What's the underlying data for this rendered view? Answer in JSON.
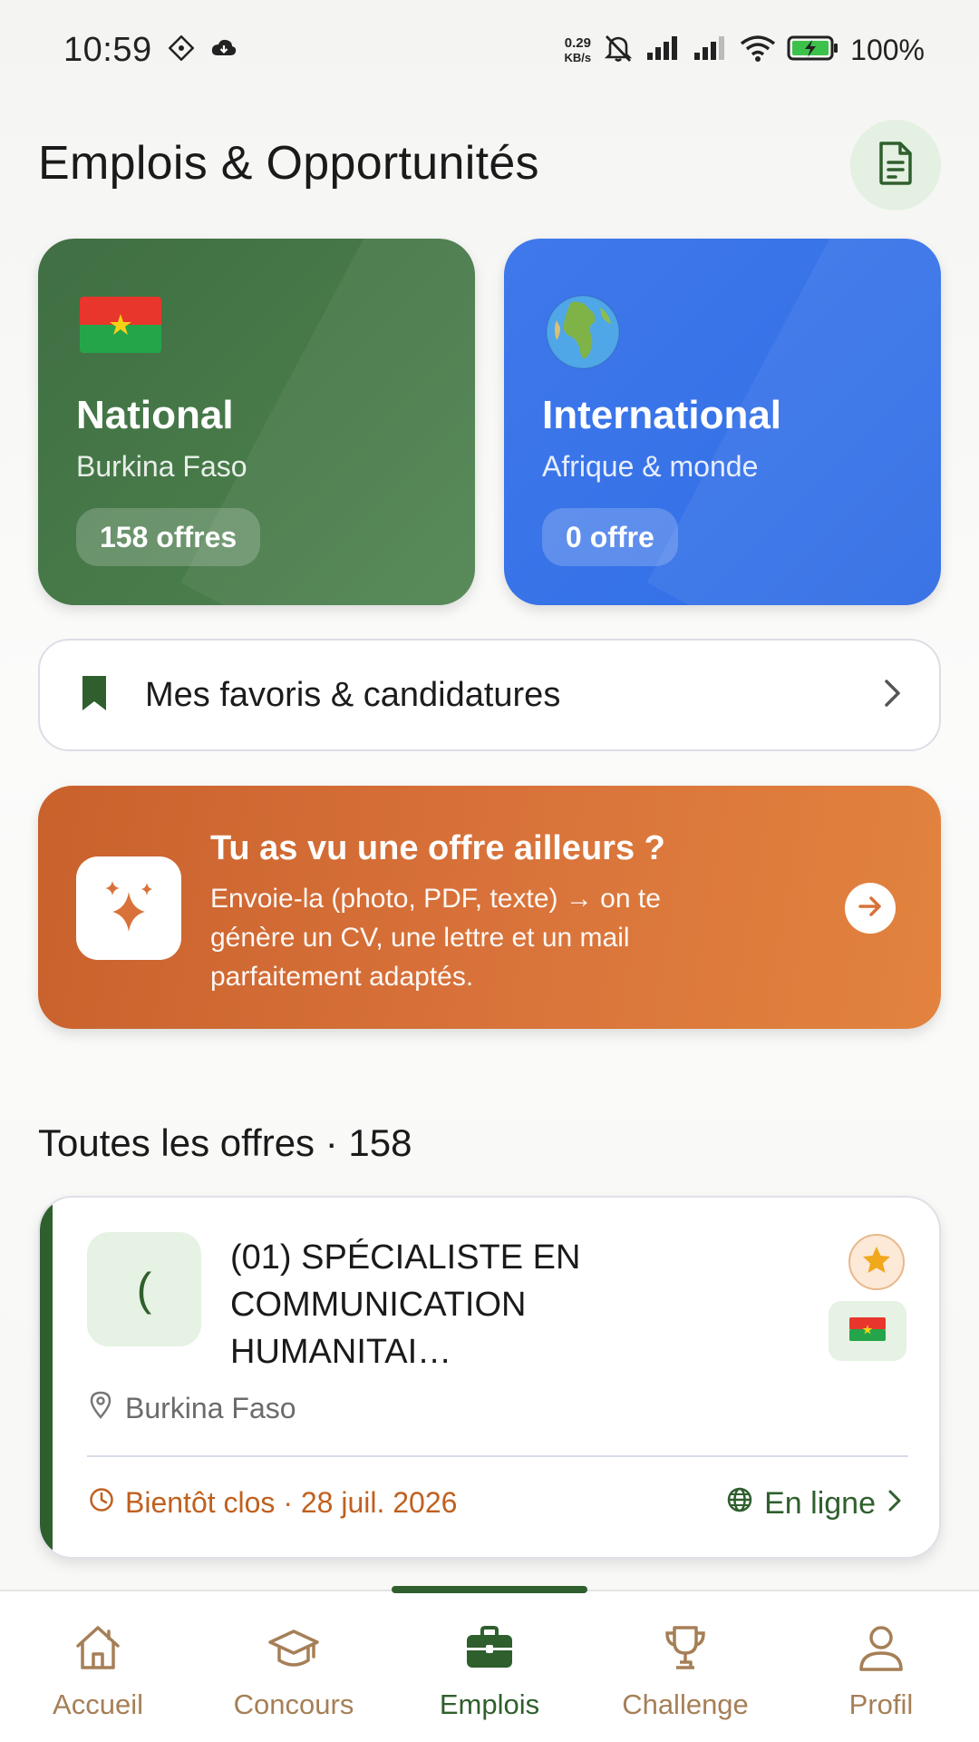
{
  "status_bar": {
    "time": "10:59",
    "net_speed_value": "0.29",
    "net_speed_unit": "KB/s",
    "battery_percent": "100%"
  },
  "header": {
    "title": "Emplois & Opportunités",
    "cv_icon": "document-icon"
  },
  "regions": [
    {
      "title": "National",
      "subtitle": "Burkina Faso",
      "badge": "158 offres",
      "icon": "burkina-flag-icon",
      "color": "#3f6f43"
    },
    {
      "title": "International",
      "subtitle": "Afrique & monde",
      "badge": "0 offre",
      "icon": "globe-icon",
      "color": "#3672e8"
    }
  ],
  "favorites": {
    "label": "Mes favoris & candidatures",
    "icon": "bookmark-icon"
  },
  "promo": {
    "title": "Tu as vu une offre ailleurs ?",
    "text": "Envoie-la (photo, PDF, texte) → on te génère un CV, une lettre et un mail parfaitement adaptés.",
    "icon": "sparkles-icon",
    "color": "#d8723a"
  },
  "offers_section": {
    "title": "Toutes les offres · 158"
  },
  "jobs": [
    {
      "logo_text": "(",
      "title": "(01) SPÉCIALISTE EN COMMUNICATION HUMANITAI…",
      "location": "Burkina Faso",
      "deadline": "Bientôt clos · 28 juil. 2026",
      "mode": "En ligne"
    }
  ],
  "bottom_nav": {
    "items": [
      {
        "label": "Accueil",
        "icon": "home-icon"
      },
      {
        "label": "Concours",
        "icon": "graduation-cap-icon"
      },
      {
        "label": "Emplois",
        "icon": "briefcase-icon",
        "active": true
      },
      {
        "label": "Challenge",
        "icon": "trophy-icon"
      },
      {
        "label": "Profil",
        "icon": "user-icon"
      }
    ]
  },
  "colors": {
    "brand_green": "#2f5f2d",
    "accent_orange": "#c0601f",
    "nav_inactive": "#a57f57"
  }
}
